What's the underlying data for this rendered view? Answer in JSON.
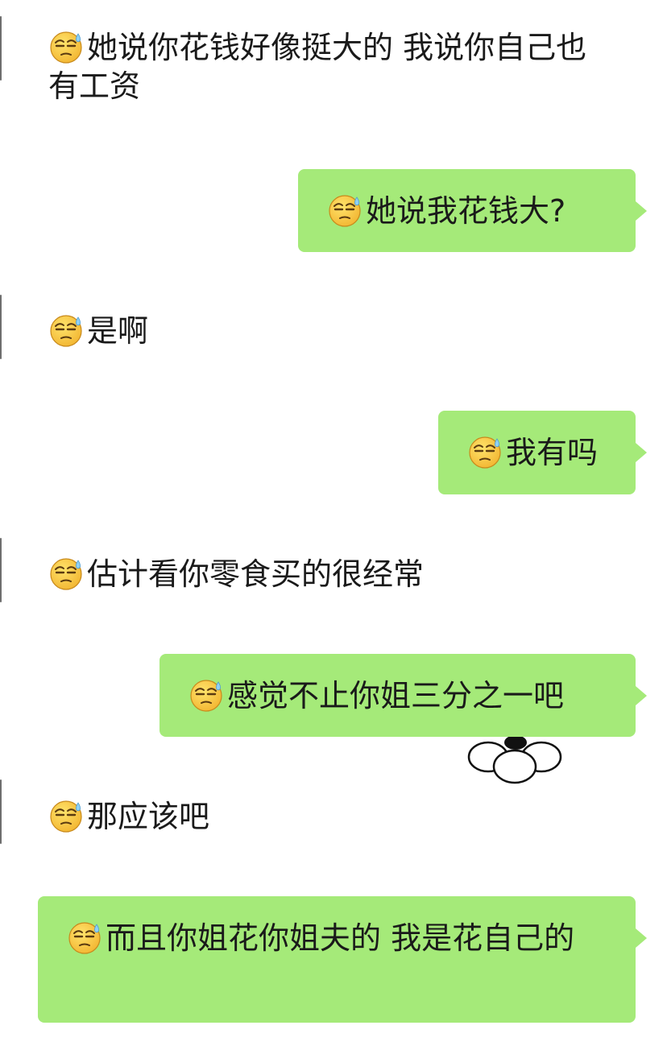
{
  "chat": {
    "emoji_icon": "sweat-smile-emoji-icon",
    "bubble_color": "#a5ea79",
    "background_color": "#ffffff",
    "messages": [
      {
        "side": "received",
        "text": "她说你花钱好像挺大的 我说你自己也有工资"
      },
      {
        "side": "sent",
        "text": "她说我花钱大?"
      },
      {
        "side": "received",
        "text": "是啊"
      },
      {
        "side": "sent",
        "text": "我有吗"
      },
      {
        "side": "received",
        "text": "估计看你零食买的很经常"
      },
      {
        "side": "sent",
        "text": "感觉不止你姐三分之一吧"
      },
      {
        "side": "received",
        "text": "那应该吧"
      },
      {
        "side": "sent",
        "text": "而且你姐花你姐夫的 我是花自己的"
      }
    ]
  }
}
